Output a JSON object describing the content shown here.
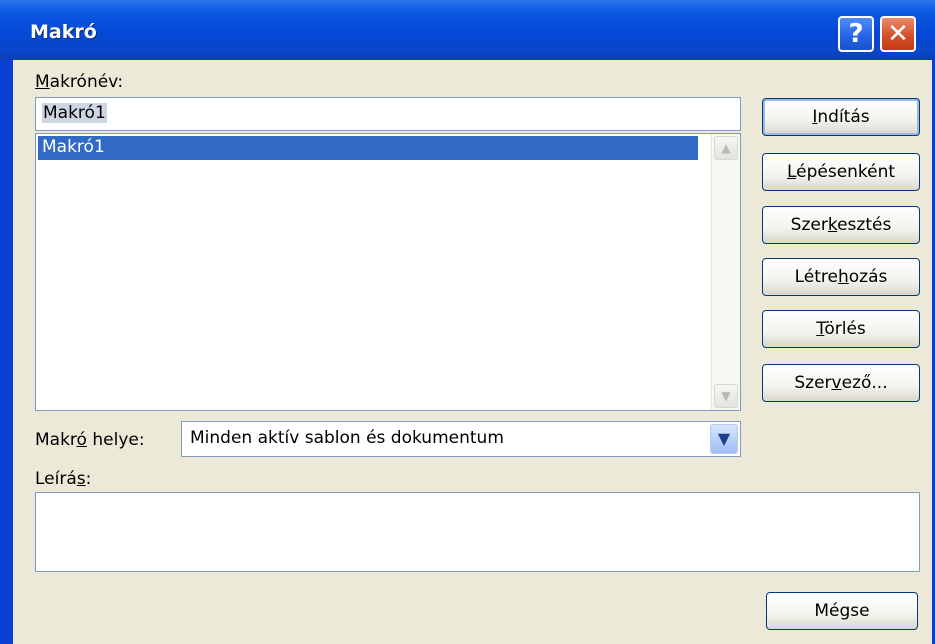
{
  "window": {
    "title": "Makró",
    "help_symbol": "?",
    "close_symbol": "✕"
  },
  "macro_name": {
    "label_underline": "M",
    "label_rest": "akrónév:",
    "value": "Makró1"
  },
  "macro_list": {
    "items": [
      "Makró1"
    ],
    "scroll_up": "▲",
    "scroll_down": "▼"
  },
  "buttons": {
    "run_pre": "",
    "run_u": "I",
    "run_post": "ndítás",
    "step_pre": "",
    "step_u": "L",
    "step_post": "épésenként",
    "edit_pre": "Szer",
    "edit_u": "k",
    "edit_post": "esztés",
    "create_pre": "Létre",
    "create_u": "h",
    "create_post": "ozás",
    "delete_pre": "",
    "delete_u": "T",
    "delete_post": "örlés",
    "organizer_pre": "Szer",
    "organizer_u": "v",
    "organizer_post": "ező...",
    "cancel": "Mégse"
  },
  "location": {
    "label_pre": "Makr",
    "label_u": "ó",
    "label_post": " helye:",
    "selected": "Minden aktív sablon és dokumentum",
    "arrow": "▼"
  },
  "description": {
    "label_pre": "Leírá",
    "label_u": "s",
    "label_post": ":",
    "value": ""
  },
  "colors": {
    "titlebar": "#0448d8",
    "client": "#ece9d8",
    "selection": "#316ac5",
    "close_button": "#d4502a"
  }
}
